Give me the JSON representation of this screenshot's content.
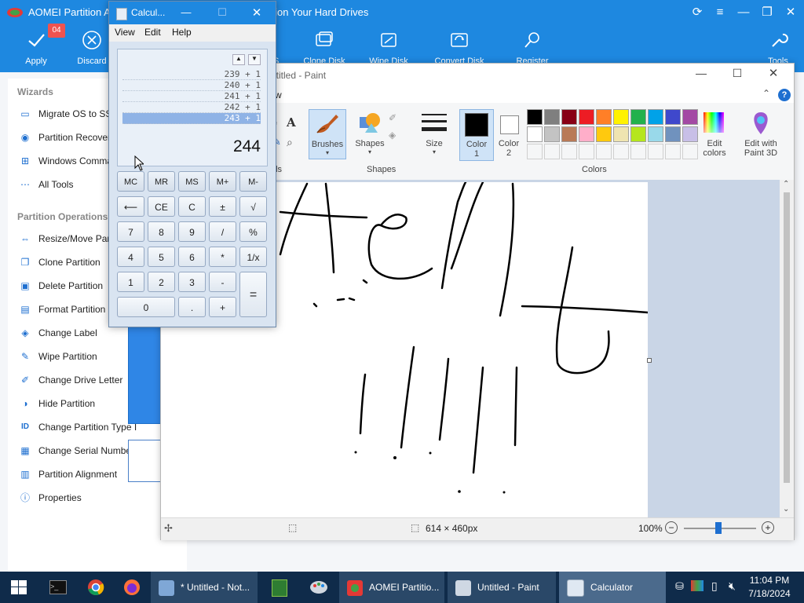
{
  "aomei": {
    "title": "AOMEI Partition A",
    "title_tail": "tition Your Hard Drives",
    "pending_badge": "04",
    "toolbar": [
      {
        "label": "Apply",
        "icon": "check-icon"
      },
      {
        "label": "Discard",
        "icon": "cancel-circle-icon"
      },
      {
        "label": "S",
        "icon": "os-icon"
      },
      {
        "label": "Clone Disk",
        "icon": "clone-disk-icon"
      },
      {
        "label": "Wipe Disk",
        "icon": "wipe-disk-icon"
      },
      {
        "label": "Convert Disk",
        "icon": "convert-disk-icon"
      },
      {
        "label": "Register",
        "icon": "key-icon"
      },
      {
        "label": "Tools",
        "icon": "wrench-icon"
      }
    ],
    "wizards_heading": "Wizards",
    "wizards": [
      {
        "label": "Migrate OS to SSD",
        "icon": "migrate-icon"
      },
      {
        "label": "Partition Recovery",
        "icon": "recovery-icon"
      },
      {
        "label": "Windows Comman",
        "icon": "windows-icon"
      },
      {
        "label": "All Tools",
        "icon": "dots-icon"
      }
    ],
    "ops_heading": "Partition Operations",
    "operations": [
      {
        "label": "Resize/Move Parti",
        "icon": "resize-icon"
      },
      {
        "label": "Clone Partition",
        "icon": "clone-icon"
      },
      {
        "label": "Delete Partition",
        "icon": "delete-icon"
      },
      {
        "label": "Format Partition",
        "icon": "format-icon"
      },
      {
        "label": "Change Label",
        "icon": "label-icon"
      },
      {
        "label": "Wipe Partition",
        "icon": "wipe-icon"
      },
      {
        "label": "Change Drive Letter",
        "icon": "drive-letter-icon"
      },
      {
        "label": "Hide Partition",
        "icon": "hide-icon"
      },
      {
        "label": "Change Partition Type I",
        "icon": "id-icon"
      },
      {
        "label": "Change Serial Number",
        "icon": "serial-icon"
      },
      {
        "label": "Partition Alignment",
        "icon": "align-icon"
      },
      {
        "label": "Properties",
        "icon": "info-icon"
      }
    ]
  },
  "paint": {
    "title": "ntitled - Paint",
    "menu_fragment": "w",
    "tools_label": "ols",
    "brushes_label": "Brushes",
    "shapes_label": "Shapes",
    "shapes_group": "Shapes",
    "size_label": "Size",
    "color1_label": "Color\n1",
    "color1_line1": "Color",
    "color1_line2": "1",
    "color2_line1": "Color",
    "color2_line2": "2",
    "colors_group": "Colors",
    "edit_colors_line1": "Edit",
    "edit_colors_line2": "colors",
    "paint3d_line1": "Edit with",
    "paint3d_line2": "Paint 3D",
    "palette_row1": [
      "#000000",
      "#7f7f7f",
      "#880015",
      "#ed1c24",
      "#ff7f27",
      "#fff200",
      "#22b14c",
      "#00a2e8",
      "#3f48cc",
      "#a349a4"
    ],
    "palette_row2": [
      "#ffffff",
      "#c3c3c3",
      "#b97a57",
      "#ffaec9",
      "#ffc90e",
      "#efe4b0",
      "#b5e61d",
      "#99d9ea",
      "#7092be",
      "#c8bfe7"
    ],
    "status_size": "614 × 460px",
    "zoom": "100%"
  },
  "calculator": {
    "title": "Calcul...",
    "menu": [
      "View",
      "Edit",
      "Help"
    ],
    "history": [
      "239 + 1",
      "240 + 1",
      "241 + 1",
      "242 + 1",
      "243 + 1"
    ],
    "display": "244",
    "buttons": {
      "mc": "MC",
      "mr": "MR",
      "ms": "MS",
      "mplus": "M+",
      "mminus": "M-",
      "back": "⟵",
      "ce": "CE",
      "c": "C",
      "pm": "±",
      "sqrt": "√",
      "n7": "7",
      "n8": "8",
      "n9": "9",
      "div": "/",
      "pct": "%",
      "n4": "4",
      "n5": "5",
      "n6": "6",
      "mul": "*",
      "inv": "1/x",
      "n1": "1",
      "n2": "2",
      "n3": "3",
      "sub": "-",
      "eq": "=",
      "n0": "0",
      "dot": ".",
      "add": "+"
    }
  },
  "taskbar": {
    "tasks": [
      {
        "label": "* Untitled - Not...",
        "icon": "notepad-icon"
      },
      {
        "label": "AOMEI Partitio...",
        "icon": "aomei-icon"
      },
      {
        "label": "Untitled - Paint",
        "icon": "paint-icon"
      },
      {
        "label": "Calculator",
        "icon": "calculator-icon"
      }
    ],
    "time": "11:04 PM",
    "date": "7/18/2024"
  }
}
